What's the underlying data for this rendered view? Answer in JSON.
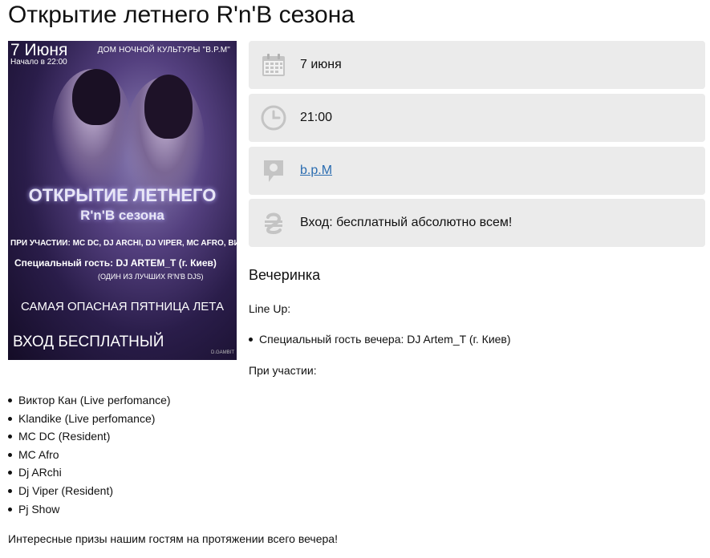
{
  "page": {
    "title": "Открытие летнего R'n'B сезона"
  },
  "poster": {
    "date": "7 Июня",
    "time": "Начало в 22:00",
    "venue": "ДОМ НОЧНОЙ КУЛЬТУРЫ \"B.P.M\"",
    "headline1": "ОТКРЫТИЕ ЛЕТНЕГО",
    "headline2": "R'n'B сезона",
    "participants": "ПРИ УЧАСТИИ: MC DC, DJ ARCHI, DJ VIPER, MC AFRO, ВИКТОР КАН",
    "guest": "Специальный гость: DJ ARTEM_T (г. Киев)",
    "guest_sub": "(ОДИН ИЗ ЛУЧШИХ R'N'B DJS)",
    "slogan": "САМАЯ ОПАСНАЯ ПЯТНИЦА ЛЕТА",
    "entry": "ВХОД БЕСПЛАТНЫЙ",
    "logo": "D.GAMBIT"
  },
  "info": {
    "date": {
      "icon": "calendar-icon",
      "value": "7 июня"
    },
    "time": {
      "icon": "clock-icon",
      "value": "21:00"
    },
    "place": {
      "icon": "location-pin-icon",
      "value": "b.p.M"
    },
    "price": {
      "icon": "hryvnia-icon",
      "value": "Вход: бесплатный абсолютно всем!"
    }
  },
  "description": {
    "heading": "Вечеринка",
    "lineup_label": "Line Up:",
    "special_guest": "Специальный гость вечера: DJ Artem_T (г. Киев)",
    "with_label": "При участии:",
    "participants": [
      "Виктор Кан (Live perfomance)",
      "Klandike (Live perfomance)",
      "MC DC (Resident)",
      "MC Afro",
      "Dj ARchi",
      "Dj Viper (Resident)",
      "Pj Show"
    ],
    "footer": "Интересные призы нашим гостям на протяжении всего вечера!"
  },
  "colors": {
    "box_bg": "#ebebeb",
    "icon_gray": "#c4c4c4",
    "link": "#2a6cb0"
  }
}
